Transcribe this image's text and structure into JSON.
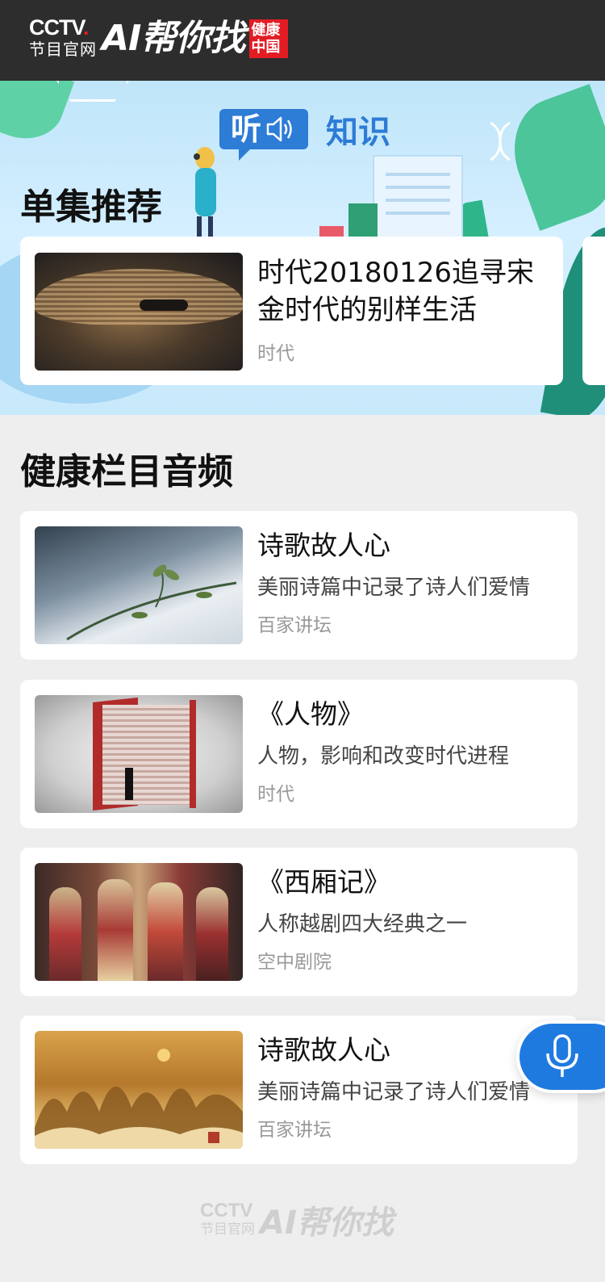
{
  "header": {
    "brand": "CCTV",
    "brand_dot": ".",
    "brand_sub": "节目官网",
    "app_name": "AI帮你找",
    "seal_text": "健康中国"
  },
  "banner": {
    "tag_listen": "听",
    "tag_knowledge": "知识",
    "title": "单集推荐",
    "featured": {
      "title": "时代20180126追寻宋金时代的别样生活",
      "source": "时代"
    }
  },
  "section": {
    "title": "健康栏目音频",
    "items": [
      {
        "title": "诗歌故人心",
        "desc": "美丽诗篇中记录了诗人们爱情",
        "source": "百家讲坛"
      },
      {
        "title": "《人物》",
        "desc": "人物，影响和改变时代进程",
        "source": "时代"
      },
      {
        "title": "《西厢记》",
        "desc": "人称越剧四大经典之一",
        "source": "空中剧院"
      },
      {
        "title": "诗歌故人心",
        "desc": "美丽诗篇中记录了诗人们爱情",
        "source": "百家讲坛"
      }
    ]
  },
  "footer": {
    "brand": "CCTV",
    "brand_sub": "节目官网",
    "app_name": "AI帮你找"
  },
  "colors": {
    "accent": "#2d7cd6",
    "mic": "#1f7ae0",
    "header_bg": "#2d2d2d",
    "seal": "#e31c24"
  },
  "icons": [
    "speaker-icon",
    "microphone-icon"
  ]
}
